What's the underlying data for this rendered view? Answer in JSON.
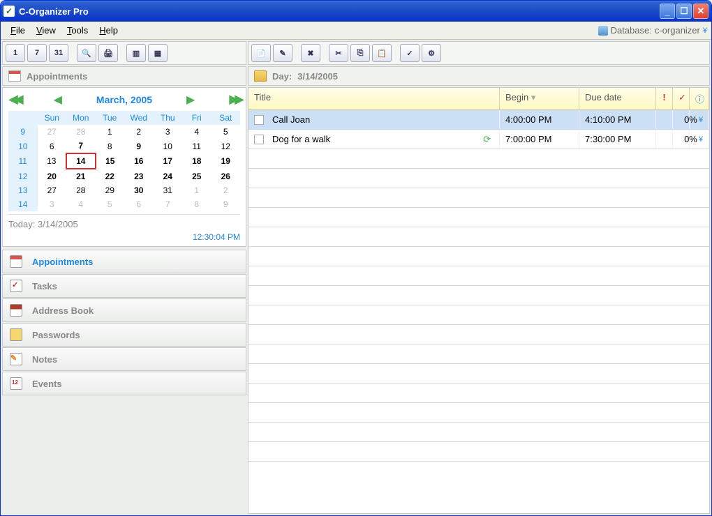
{
  "window": {
    "title": "C-Organizer Pro"
  },
  "menubar": {
    "file": "File",
    "view": "View",
    "tools": "Tools",
    "help": "Help",
    "database_label": "Database:",
    "database_name": "c-organizer"
  },
  "left_toolbar": {
    "btn1": "1",
    "btn7": "7",
    "btn31": "31"
  },
  "left_header": {
    "title": "Appointments"
  },
  "calendar": {
    "month_label": "March, 2005",
    "day_headers": [
      "Sun",
      "Mon",
      "Tue",
      "Wed",
      "Thu",
      "Fri",
      "Sat"
    ],
    "weeks": [
      {
        "wk": "9",
        "days": [
          {
            "d": "27",
            "o": true
          },
          {
            "d": "28",
            "o": true
          },
          {
            "d": "1"
          },
          {
            "d": "2"
          },
          {
            "d": "3"
          },
          {
            "d": "4"
          },
          {
            "d": "5"
          }
        ]
      },
      {
        "wk": "10",
        "days": [
          {
            "d": "6"
          },
          {
            "d": "7",
            "b": true
          },
          {
            "d": "8"
          },
          {
            "d": "9",
            "b": true
          },
          {
            "d": "10"
          },
          {
            "d": "11"
          },
          {
            "d": "12"
          }
        ]
      },
      {
        "wk": "11",
        "days": [
          {
            "d": "13"
          },
          {
            "d": "14",
            "b": true,
            "sel": true
          },
          {
            "d": "15",
            "b": true
          },
          {
            "d": "16",
            "b": true
          },
          {
            "d": "17",
            "b": true
          },
          {
            "d": "18",
            "b": true
          },
          {
            "d": "19",
            "b": true
          }
        ]
      },
      {
        "wk": "12",
        "days": [
          {
            "d": "20",
            "b": true
          },
          {
            "d": "21",
            "b": true
          },
          {
            "d": "22",
            "b": true
          },
          {
            "d": "23",
            "b": true
          },
          {
            "d": "24",
            "b": true
          },
          {
            "d": "25",
            "b": true
          },
          {
            "d": "26",
            "b": true
          }
        ]
      },
      {
        "wk": "13",
        "days": [
          {
            "d": "27"
          },
          {
            "d": "28"
          },
          {
            "d": "29"
          },
          {
            "d": "30",
            "b": true
          },
          {
            "d": "31"
          },
          {
            "d": "1",
            "o": true
          },
          {
            "d": "2",
            "o": true
          }
        ]
      },
      {
        "wk": "14",
        "days": [
          {
            "d": "3",
            "o": true
          },
          {
            "d": "4",
            "o": true
          },
          {
            "d": "5",
            "o": true
          },
          {
            "d": "6",
            "o": true
          },
          {
            "d": "7",
            "o": true
          },
          {
            "d": "8",
            "o": true
          },
          {
            "d": "9",
            "o": true
          }
        ]
      }
    ],
    "today_label": "Today: 3/14/2005",
    "time": "12:30:04 PM"
  },
  "nav": {
    "appointments": "Appointments",
    "tasks": "Tasks",
    "address_book": "Address Book",
    "passwords": "Passwords",
    "notes": "Notes",
    "events": "Events"
  },
  "right_header": {
    "prefix": "Day:",
    "date": "3/14/2005"
  },
  "grid": {
    "col_title": "Title",
    "col_begin": "Begin",
    "col_due": "Due date",
    "col_flag": "!",
    "col_check": "✓",
    "col_info": "ⓘ",
    "rows": [
      {
        "title": "Call Joan",
        "begin": "4:00:00 PM",
        "due": "4:10:00 PM",
        "progress": "0%",
        "recurring": false,
        "selected": true
      },
      {
        "title": "Dog for a walk",
        "begin": "7:00:00 PM",
        "due": "7:30:00 PM",
        "progress": "0%",
        "recurring": true,
        "selected": false
      }
    ]
  }
}
